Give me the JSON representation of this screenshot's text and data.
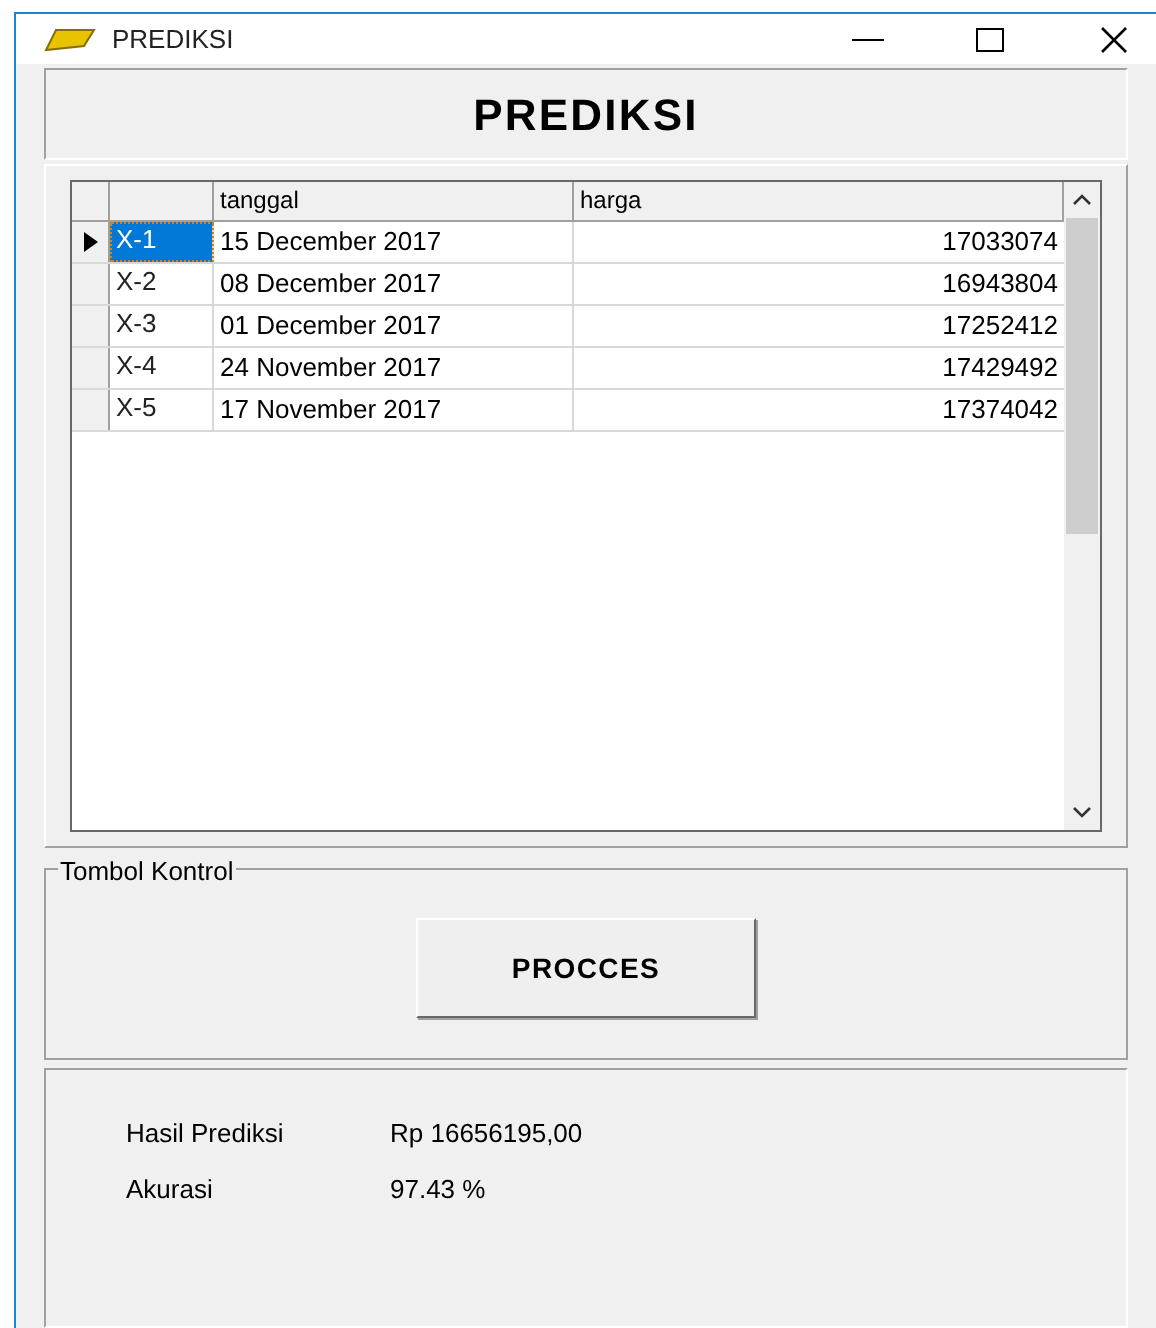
{
  "window": {
    "title": "PREDIKSI"
  },
  "header": "PREDIKSI",
  "table": {
    "columns": [
      "tanggal",
      "harga"
    ],
    "rows": [
      {
        "label": "X-1",
        "tanggal": "15 December 2017",
        "harga": "17033074",
        "selected": true
      },
      {
        "label": "X-2",
        "tanggal": "08 December 2017",
        "harga": "16943804",
        "selected": false
      },
      {
        "label": "X-3",
        "tanggal": "01 December 2017",
        "harga": "17252412",
        "selected": false
      },
      {
        "label": "X-4",
        "tanggal": "24 November 2017",
        "harga": "17429492",
        "selected": false
      },
      {
        "label": "X-5",
        "tanggal": "17 November 2017",
        "harga": "17374042",
        "selected": false
      }
    ]
  },
  "control_group": {
    "title": "Tombol Kontrol",
    "button": "PROCCES"
  },
  "results": [
    {
      "label": "Hasil Prediksi",
      "value": "Rp 16656195,00"
    },
    {
      "label": "Akurasi",
      "value": "97.43 %"
    }
  ]
}
